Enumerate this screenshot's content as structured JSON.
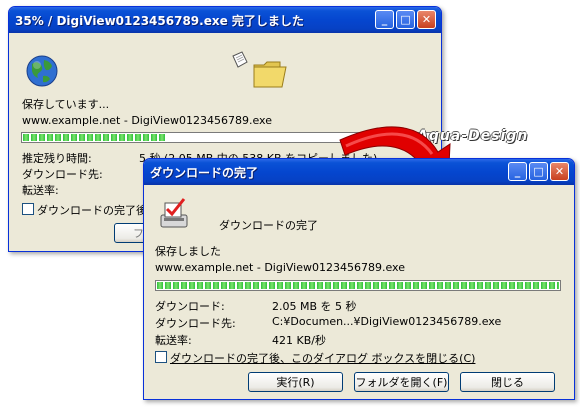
{
  "back_window": {
    "title": "35% / DigiView0123456789.exe 完了しました",
    "status": "保存しています...",
    "source": "www.example.net - DigiView0123456789.exe",
    "progress": 0.35,
    "labels": {
      "remaining": "推定残り時間:",
      "dest": "ダウンロード先:",
      "rate": "転送率:"
    },
    "remaining_value": "5 秒 (2.05 MB 中の 538 KB をコピーしました)",
    "checkbox_label": "ダウンロードの完了後",
    "button_fragment": "ファ"
  },
  "front_window": {
    "title": "ダウンロードの完了",
    "heading": "ダウンロードの完了",
    "status": "保存しました",
    "source": "www.example.net - DigiView0123456789.exe",
    "progress": 1.0,
    "rows": [
      {
        "label": "ダウンロード:",
        "value": "2.05 MB を 5 秒"
      },
      {
        "label": "ダウンロード先:",
        "value": "C:¥Documen...¥DigiView0123456789.exe"
      },
      {
        "label": "転送率:",
        "value": "421 KB/秒"
      }
    ],
    "checkbox_label": "ダウンロードの完了後、このダイアログ ボックスを閉じる(C)",
    "buttons": {
      "run": "実行(R)",
      "open_folder": "フォルダを開く(F)",
      "close": "閉じる"
    }
  },
  "watermark": "Aqua-Design",
  "titlebar_buttons": {
    "minimize": "_",
    "maximize": "□",
    "close": "✕"
  },
  "colors": {
    "arrow": "#e00000",
    "progress": "#2ec03a",
    "titlebar": "#0546cf"
  }
}
